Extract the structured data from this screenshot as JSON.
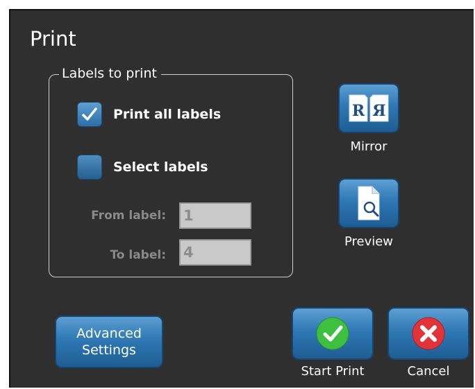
{
  "dialog": {
    "title": "Print",
    "group_legend": "Labels to print",
    "options": {
      "print_all": {
        "label": "Print all labels",
        "checked": true
      },
      "select": {
        "label": "Select labels",
        "checked": false
      }
    },
    "range": {
      "from_label": "From label:",
      "from_value": "1",
      "to_label": "To label:",
      "to_value": "4"
    },
    "mirror": {
      "label": "Mirror",
      "icon": "mirror-icon",
      "glyphs": [
        "R",
        "Я"
      ]
    },
    "preview": {
      "label": "Preview",
      "icon": "preview-icon"
    },
    "advanced": {
      "line1": "Advanced",
      "line2": "Settings"
    },
    "start_print": {
      "label": "Start Print",
      "icon": "checkmark-icon",
      "color": "#3fbf3f"
    },
    "cancel": {
      "label": "Cancel",
      "icon": "close-icon",
      "color": "#e0333a"
    }
  }
}
